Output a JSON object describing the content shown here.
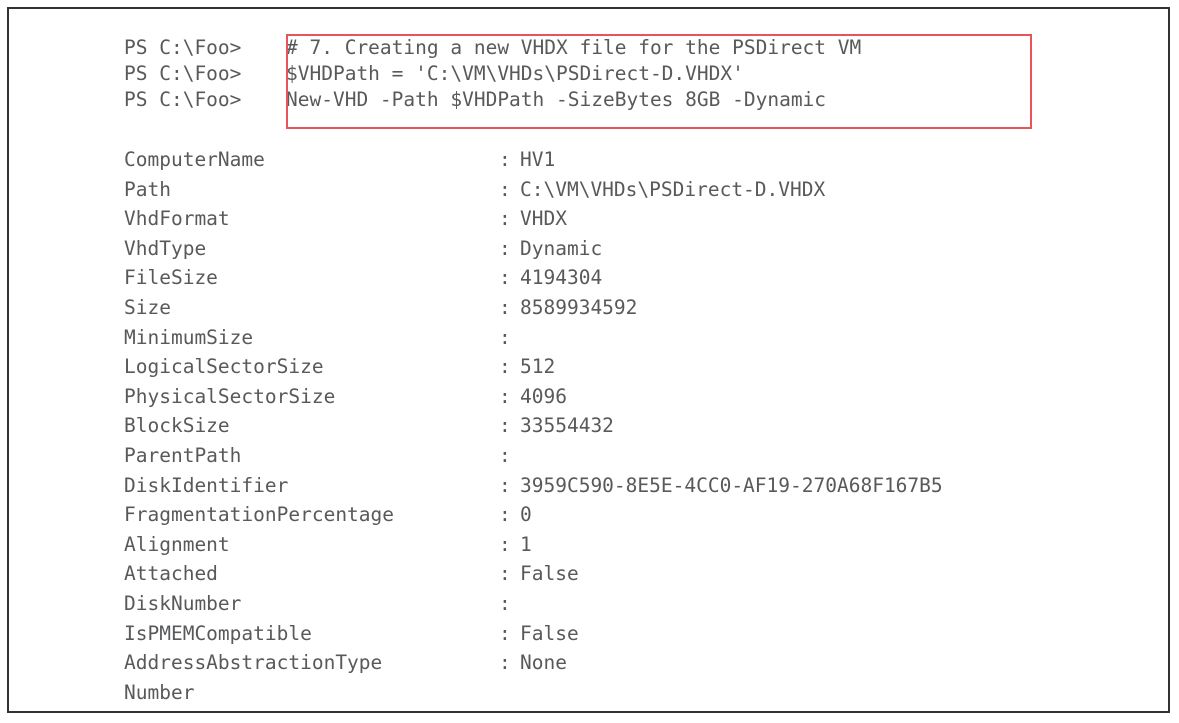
{
  "window": {
    "border_color": "#2f3336",
    "background_color": "#ffffff",
    "text_color": "#58595b"
  },
  "annotation": {
    "highlight_box_color": "#e8545a",
    "highlight_box_label": "red-rectangle-around-commands"
  },
  "console": {
    "prompt": "PS C:\\Foo>",
    "command_lines": [
      {
        "prompt": "PS C:\\Foo>",
        "command": "# 7. Creating a new VHDX file for the PSDirect VM"
      },
      {
        "prompt": "PS C:\\Foo>",
        "command": "$VHDPath = 'C:\\VM\\VHDs\\PSDirect-D.VHDX'"
      },
      {
        "prompt": "PS C:\\Foo>",
        "command": "New-VHD -Path $VHDPath -SizeBytes 8GB -Dynamic"
      }
    ],
    "separator": ":",
    "properties": [
      {
        "name": "ComputerName",
        "value": "HV1"
      },
      {
        "name": "Path",
        "value": "C:\\VM\\VHDs\\PSDirect-D.VHDX"
      },
      {
        "name": "VhdFormat",
        "value": "VHDX"
      },
      {
        "name": "VhdType",
        "value": "Dynamic"
      },
      {
        "name": "FileSize",
        "value": "4194304"
      },
      {
        "name": "Size",
        "value": "8589934592"
      },
      {
        "name": "MinimumSize",
        "value": ""
      },
      {
        "name": "LogicalSectorSize",
        "value": "512"
      },
      {
        "name": "PhysicalSectorSize",
        "value": "4096"
      },
      {
        "name": "BlockSize",
        "value": "33554432"
      },
      {
        "name": "ParentPath",
        "value": ""
      },
      {
        "name": "DiskIdentifier",
        "value": "3959C590-8E5E-4CC0-AF19-270A68F167B5"
      },
      {
        "name": "FragmentationPercentage",
        "value": "0"
      },
      {
        "name": "Alignment",
        "value": "1"
      },
      {
        "name": "Attached",
        "value": "False"
      },
      {
        "name": "DiskNumber",
        "value": ""
      },
      {
        "name": "IsPMEMCompatible",
        "value": "False"
      },
      {
        "name": "AddressAbstractionType",
        "value": "None"
      },
      {
        "name": "Number",
        "value": "",
        "no_separator": true
      }
    ]
  }
}
